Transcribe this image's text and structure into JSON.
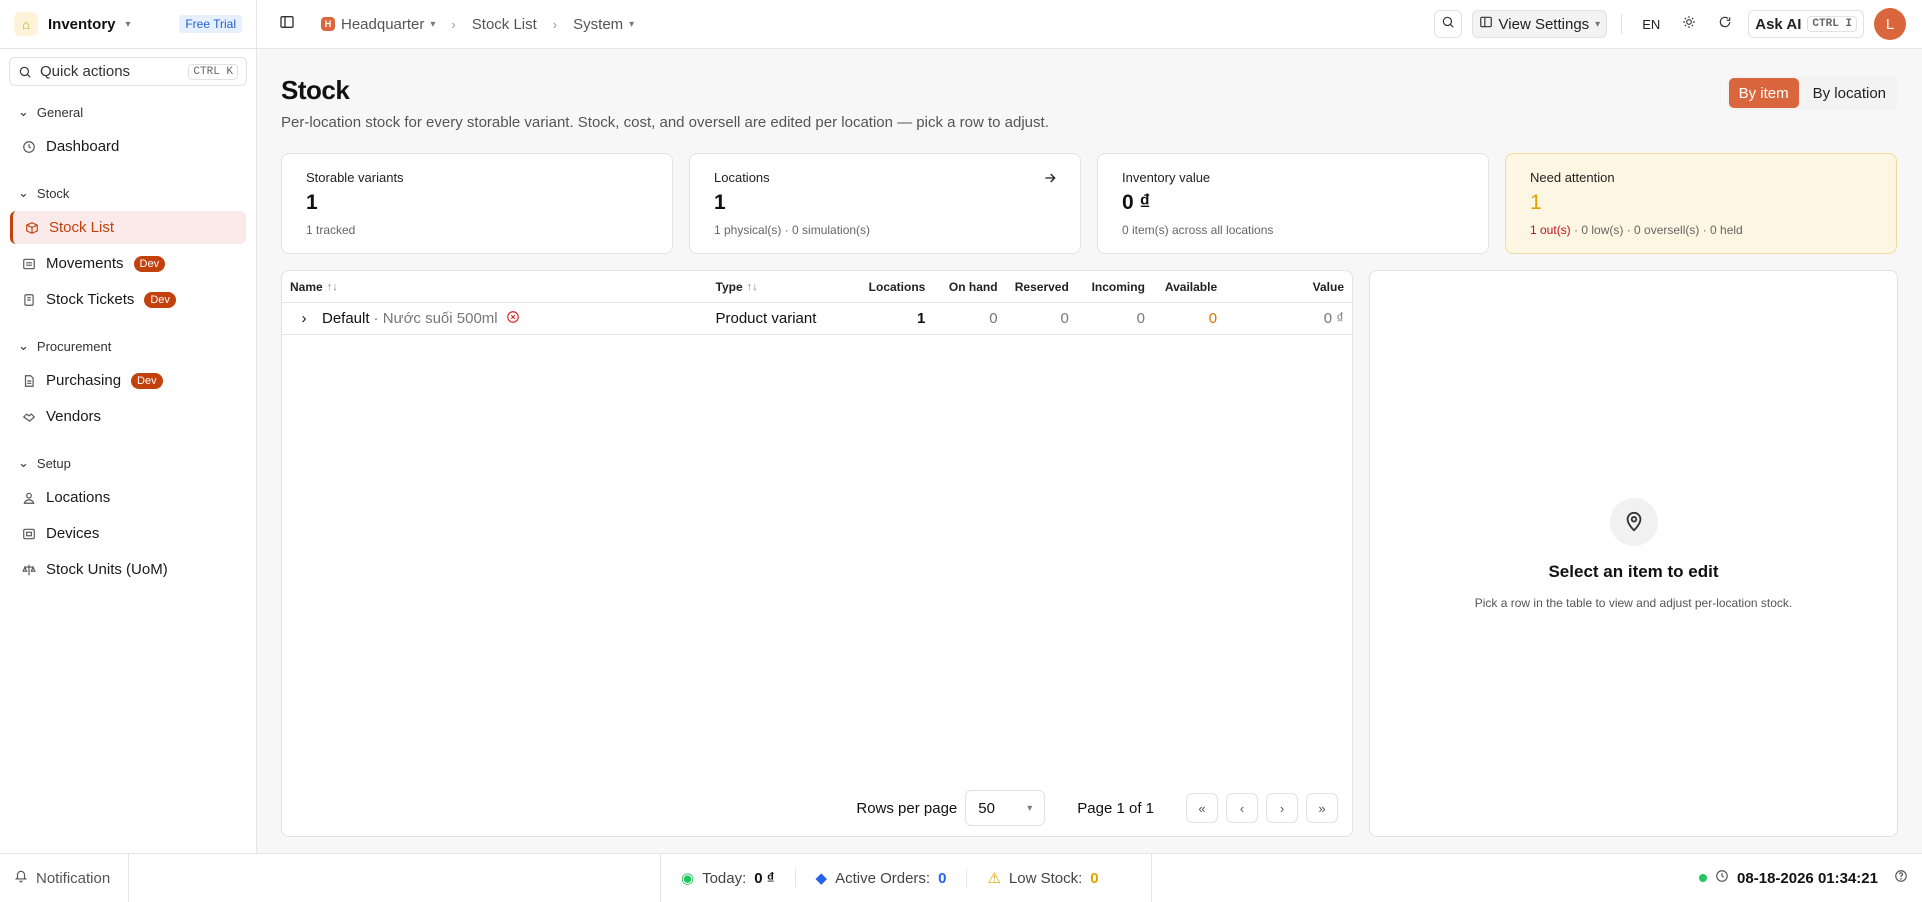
{
  "app": {
    "name": "Inventory",
    "badge": "Free Trial"
  },
  "quick_actions": {
    "label": "Quick actions",
    "shortcut": "CTRL K"
  },
  "sidebar": {
    "sections": [
      {
        "title": "General",
        "items": [
          {
            "label": "Dashboard",
            "icon": "clock-icon"
          }
        ]
      },
      {
        "title": "Stock",
        "items": [
          {
            "label": "Stock List",
            "icon": "box-icon",
            "active": true
          },
          {
            "label": "Movements",
            "icon": "arrows-icon",
            "badge": "Dev"
          },
          {
            "label": "Stock Tickets",
            "icon": "ticket-icon",
            "badge": "Dev"
          }
        ]
      },
      {
        "title": "Procurement",
        "items": [
          {
            "label": "Purchasing",
            "icon": "doc-icon",
            "badge": "Dev"
          },
          {
            "label": "Vendors",
            "icon": "handshake-icon"
          }
        ]
      },
      {
        "title": "Setup",
        "items": [
          {
            "label": "Locations",
            "icon": "user-pin-icon"
          },
          {
            "label": "Devices",
            "icon": "device-icon"
          },
          {
            "label": "Stock Units (UoM)",
            "icon": "scale-icon"
          }
        ]
      }
    ]
  },
  "header": {
    "breadcrumb": [
      {
        "label": "Headquarter",
        "initial": "H"
      },
      {
        "label": "Stock List"
      },
      {
        "label": "System"
      }
    ],
    "view_settings": "View Settings",
    "lang": "EN",
    "ask_ai": "Ask AI",
    "ask_ai_shortcut": "CTRL I",
    "avatar_initial": "L"
  },
  "page": {
    "title": "Stock",
    "description": "Per-location stock for every storable variant. Stock, cost, and oversell are edited per location — pick a row to adjust.",
    "toggle": {
      "by_item": "By item",
      "by_location": "By location"
    }
  },
  "cards": [
    {
      "label": "Storable variants",
      "value": "1",
      "sub": "1 tracked"
    },
    {
      "label": "Locations",
      "value": "1",
      "sub": "1 physical(s) · 0 simulation(s)"
    },
    {
      "label": "Inventory value",
      "value": "0 ₫",
      "sub": "0 item(s) across all locations"
    },
    {
      "label": "Need attention",
      "value": "1",
      "sub_red": "1 out(s)",
      "sub": " · 0 low(s) · 0 oversell(s) · 0 held"
    }
  ],
  "table": {
    "headers": {
      "name": "Name",
      "type": "Type",
      "locations": "Locations",
      "on_hand": "On hand",
      "reserved": "Reserved",
      "incoming": "Incoming",
      "available": "Available",
      "value": "Value"
    },
    "rows": [
      {
        "name": "Default",
        "sub": "· Nước suối 500ml",
        "type": "Product variant",
        "locations": "1",
        "on_hand": "0",
        "reserved": "0",
        "incoming": "0",
        "available": "0",
        "value": "0 ₫"
      }
    ],
    "pager": {
      "rows_label": "Rows per page",
      "rows_value": "50",
      "page_info": "Page 1 of 1"
    }
  },
  "detail": {
    "title": "Select an item to edit",
    "sub": "Pick a row in the table to view and adjust per-location stock."
  },
  "footer": {
    "notification": "Notification",
    "today_label": "Today:",
    "today_value": "0 ₫",
    "orders_label": "Active Orders:",
    "orders_value": "0",
    "low_label": "Low Stock:",
    "low_value": "0",
    "datetime": "08-18-2026 01:34:21"
  }
}
